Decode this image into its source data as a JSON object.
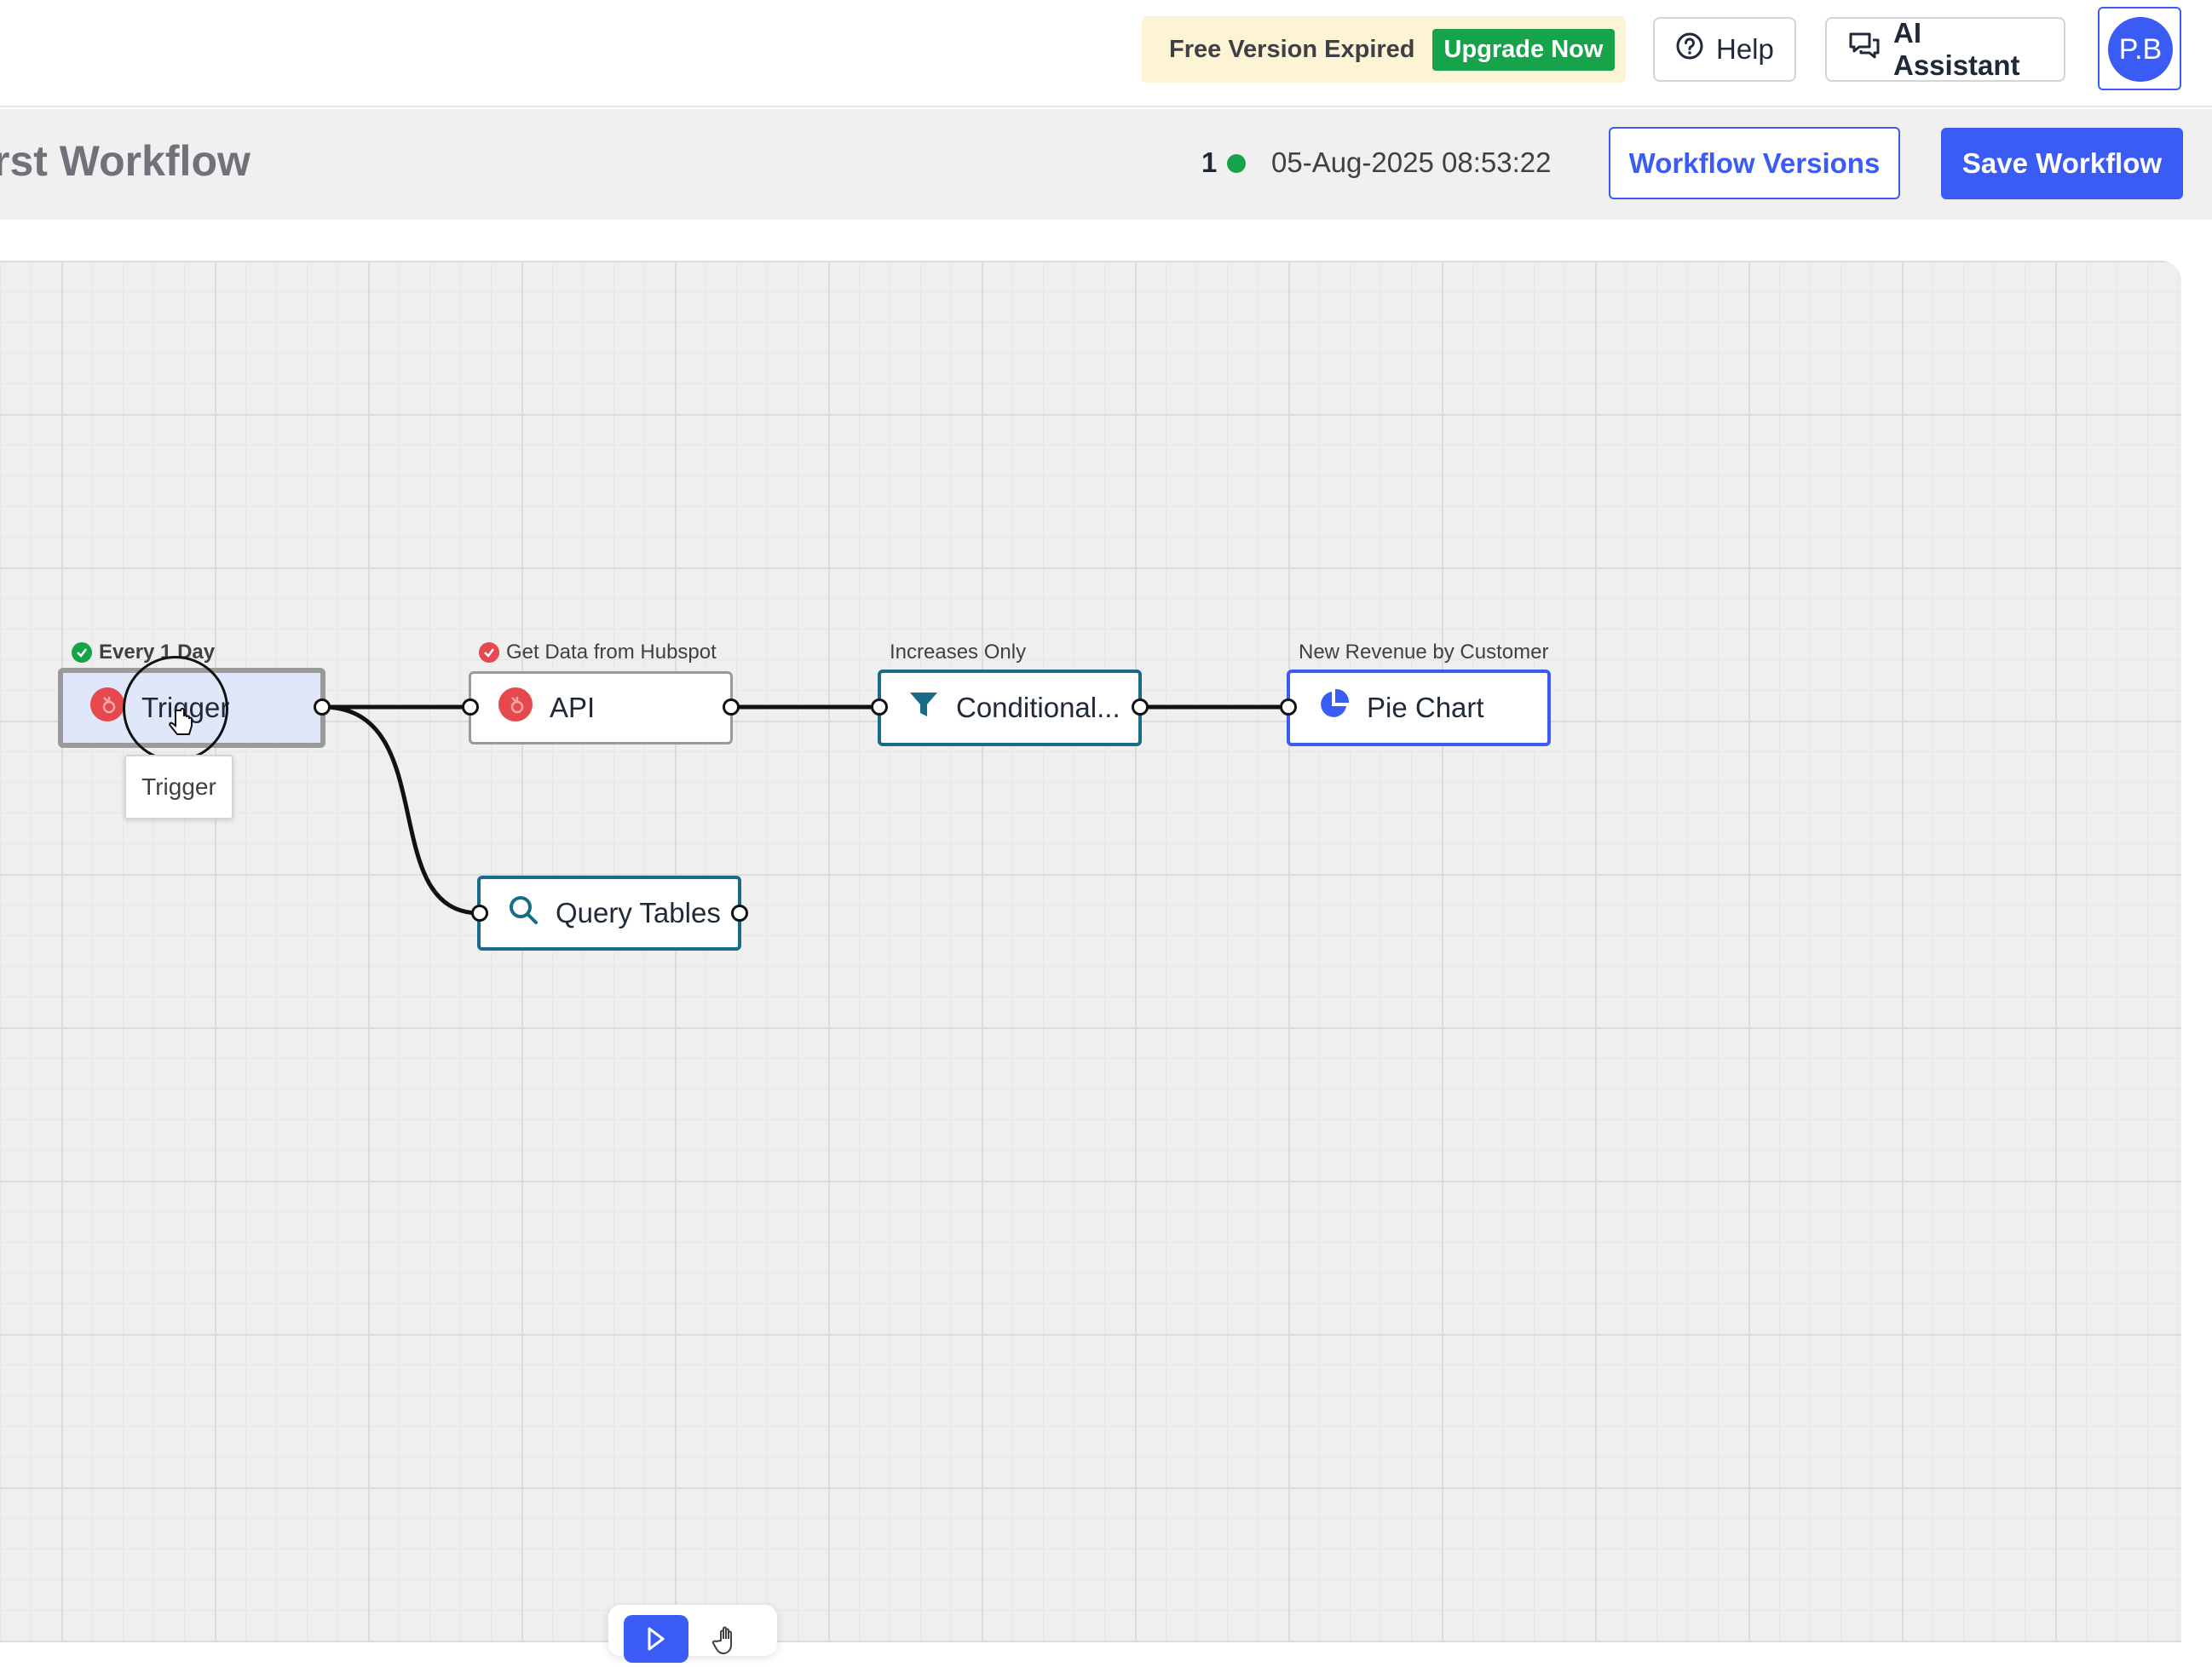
{
  "topbar": {
    "expired_text": "Free Version Expired",
    "upgrade_label": "Upgrade Now",
    "help_label": "Help",
    "ai_label": "AI Assistant",
    "avatar_initials": "P.B"
  },
  "header": {
    "workflow_title": "rst Workflow",
    "version_count": "1",
    "timestamp": "05-Aug-2025 08:53:22",
    "versions_label": "Workflow Versions",
    "save_label": "Save Workflow"
  },
  "nodes": {
    "trigger": {
      "caption": "Every 1 Day",
      "label": "Trigger",
      "tooltip": "Trigger"
    },
    "api": {
      "caption": "Get Data from Hubspot",
      "label": "API"
    },
    "conditional": {
      "caption": "Increases Only",
      "label": "Conditional..."
    },
    "pie": {
      "caption": "New Revenue by Customer",
      "label": "Pie Chart"
    },
    "query": {
      "label": "Query Tables"
    }
  },
  "colors": {
    "accent": "#3b5bf5",
    "success": "#16a34a",
    "error": "#e5484d",
    "teal": "#1a6b8a",
    "warning_bg": "#fdf3d5"
  },
  "icons": {
    "help": "question-circle-icon",
    "ai": "chat-bubbles-icon",
    "trigger": "hubspot-icon",
    "api": "hubspot-icon",
    "conditional": "filter-icon",
    "pie": "pie-chart-icon",
    "query": "search-icon"
  }
}
